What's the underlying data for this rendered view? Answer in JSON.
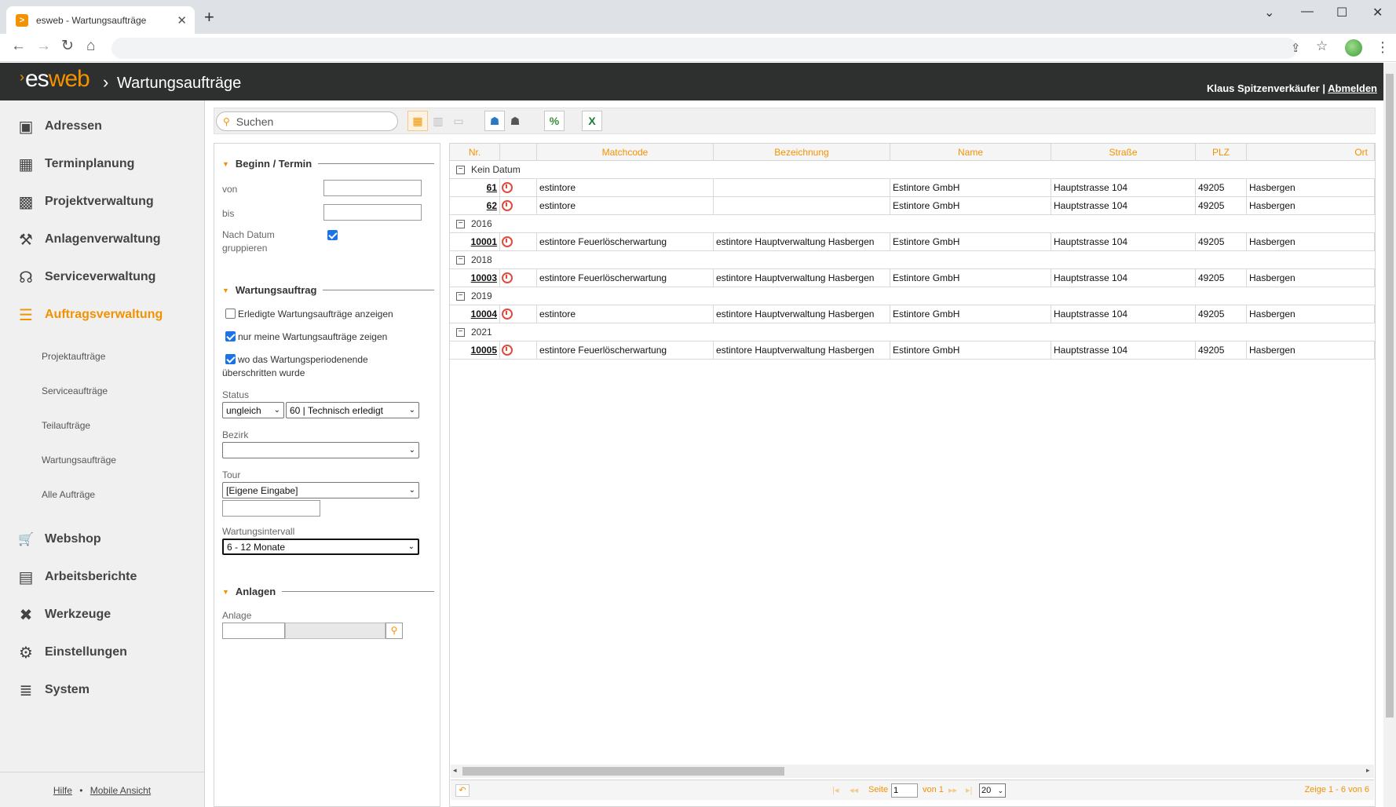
{
  "browser": {
    "tab_title": "esweb - Wartungsaufträge",
    "tab_favicon": ">",
    "close_glyph": "✕",
    "newtab_glyph": "+",
    "win_min": "—",
    "win_max": "☐",
    "win_close": "✕",
    "win_tabsearch": "⌄",
    "nav_back": "←",
    "nav_forward": "→",
    "nav_reload": "↻",
    "nav_home": "⌂",
    "share_glyph": "⇪",
    "star_glyph": "☆",
    "menu_glyph": "⋮"
  },
  "header": {
    "logo_chevron": "›",
    "logo_es": "es",
    "logo_web": "web",
    "separator": "›",
    "title": "Wartungsaufträge",
    "user_name": "Klaus Spitzenverkäufer",
    "user_sep": "|",
    "logout": "Abmelden"
  },
  "sidebar": {
    "items": [
      {
        "label": "Adressen",
        "icon": "▣",
        "icon_name": "address-book-icon"
      },
      {
        "label": "Terminplanung",
        "icon": "▦",
        "icon_name": "calendar-icon"
      },
      {
        "label": "Projektverwaltung",
        "icon": "▩",
        "icon_name": "project-board-icon"
      },
      {
        "label": "Anlagenverwaltung",
        "icon": "⚒",
        "icon_name": "factory-icon"
      },
      {
        "label": "Serviceverwaltung",
        "icon": "☊",
        "icon_name": "headset-icon"
      },
      {
        "label": "Auftragsverwaltung",
        "icon": "☰",
        "icon_name": "order-list-icon"
      },
      {
        "label": "Webshop",
        "icon": "🛒",
        "icon_name": "cart-icon"
      },
      {
        "label": "Arbeitsberichte",
        "icon": "▤",
        "icon_name": "clipboard-icon"
      },
      {
        "label": "Werkzeuge",
        "icon": "✖",
        "icon_name": "tools-icon"
      },
      {
        "label": "Einstellungen",
        "icon": "⚙",
        "icon_name": "gears-icon"
      },
      {
        "label": "System",
        "icon": "≣",
        "icon_name": "database-icon"
      }
    ],
    "subitems": [
      "Projektaufträge",
      "Serviceaufträge",
      "Teilaufträge",
      "Wartungsaufträge",
      "Alle Aufträge"
    ],
    "footer": {
      "help": "Hilfe",
      "dot": "•",
      "mobile": "Mobile Ansicht"
    }
  },
  "toolbar": {
    "search_placeholder": "Suchen",
    "search_glyph": "⚲",
    "btn_grid": "▦",
    "btn_detail": "▥",
    "btn_folder": "▭",
    "btn_user_blue": "☗",
    "btn_user_gray": "☗",
    "btn_percent": "%",
    "btn_excel": "X"
  },
  "filter": {
    "sec_termin": "Beginn / Termin",
    "von": "von",
    "bis": "bis",
    "group_label_1": "Nach Datum",
    "group_label_2": "gruppieren",
    "group_checked": true,
    "sec_wartung": "Wartungsauftrag",
    "cb1_label": "Erledigte Wartungsaufträge anzeigen",
    "cb1_checked": false,
    "cb2_label": "nur meine Wartungsaufträge zeigen",
    "cb2_checked": true,
    "cb3_label_1": "wo das Wartungsperiodenende",
    "cb3_label_2": "überschritten wurde",
    "cb3_checked": true,
    "status_label": "Status",
    "status_op": "ungleich",
    "status_value": "60 | Technisch erledigt",
    "bezirk_label": "Bezirk",
    "bezirk_value": "",
    "tour_label": "Tour",
    "tour_value": "[Eigene Eingabe]",
    "tour_input": "",
    "intervall_label": "Wartungsintervall",
    "intervall_value": "6 - 12 Monate",
    "sec_anlagen": "Anlagen",
    "anlage_label": "Anlage",
    "caret": "⌄",
    "tri": "▼"
  },
  "grid": {
    "columns": [
      "Nr.",
      "",
      "Matchcode",
      "Bezeichnung",
      "Name",
      "Straße",
      "PLZ",
      "Ort"
    ],
    "toggle_glyph": "−",
    "groups": [
      {
        "label": "Kein Datum",
        "rows": [
          {
            "nr": "61",
            "matchcode": "estintore",
            "bezeichnung": "",
            "name": "Estintore GmbH",
            "strasse": "Hauptstrasse 104",
            "plz": "49205",
            "ort": "Hasbergen"
          },
          {
            "nr": "62",
            "matchcode": "estintore",
            "bezeichnung": "",
            "name": "Estintore GmbH",
            "strasse": "Hauptstrasse 104",
            "plz": "49205",
            "ort": "Hasbergen"
          }
        ]
      },
      {
        "label": "2016",
        "rows": [
          {
            "nr": "10001",
            "matchcode": "estintore Feuerlöscherwartung",
            "bezeichnung": "estintore Hauptverwaltung Hasbergen",
            "name": "Estintore GmbH",
            "strasse": "Hauptstrasse 104",
            "plz": "49205",
            "ort": "Hasbergen"
          }
        ]
      },
      {
        "label": "2018",
        "rows": [
          {
            "nr": "10003",
            "matchcode": "estintore Feuerlöscherwartung",
            "bezeichnung": "estintore Hauptverwaltung Hasbergen",
            "name": "Estintore GmbH",
            "strasse": "Hauptstrasse 104",
            "plz": "49205",
            "ort": "Hasbergen"
          }
        ]
      },
      {
        "label": "2019",
        "rows": [
          {
            "nr": "10004",
            "matchcode": "estintore",
            "bezeichnung": "estintore Hauptverwaltung Hasbergen",
            "name": "Estintore GmbH",
            "strasse": "Hauptstrasse 104",
            "plz": "49205",
            "ort": "Hasbergen"
          }
        ]
      },
      {
        "label": "2021",
        "rows": [
          {
            "nr": "10005",
            "matchcode": "estintore Feuerlöscherwartung",
            "bezeichnung": "estintore Hauptverwaltung Hasbergen",
            "name": "Estintore GmbH",
            "strasse": "Hauptstrasse 104",
            "plz": "49205",
            "ort": "Hasbergen"
          }
        ]
      }
    ]
  },
  "pager": {
    "back": "↶",
    "first": "|◂",
    "prev": "◂◂",
    "seite": "Seite",
    "page": "1",
    "von": "von 1",
    "next": "▸▸",
    "last": "▸|",
    "page_size": "20",
    "summary": "Zeige 1 - 6 von 6",
    "scroll_left": "◂",
    "scroll_right": "▸"
  },
  "colors": {
    "accent": "#f39200",
    "header_bg": "#2e3030",
    "status_icon": "#e24a3b"
  }
}
